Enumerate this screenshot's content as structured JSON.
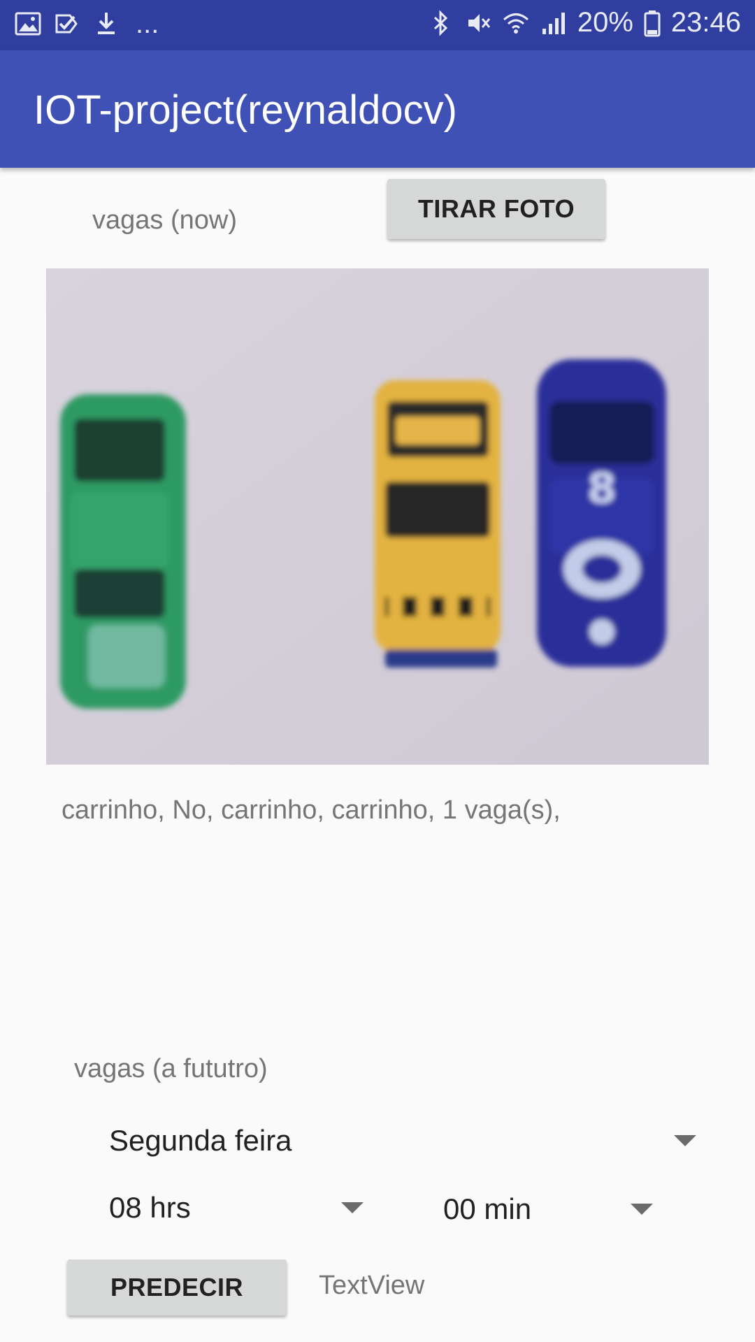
{
  "status_bar": {
    "left_icons": [
      "image-icon",
      "check-notification-icon",
      "download-icon"
    ],
    "more": "...",
    "right_icons": [
      "bluetooth-icon",
      "mute-icon",
      "wifi-icon",
      "signal-icon"
    ],
    "battery": "20%",
    "time": "23:46",
    "color": "#303f9f"
  },
  "app_bar": {
    "title": "IOT-project(reynaldocv)",
    "color": "#3f51b5"
  },
  "now_section": {
    "label": "vagas (now)",
    "photo_button": "TIRAR FOTO",
    "result": "carrinho, No, carrinho, carrinho, 1 vaga(s),"
  },
  "future_section": {
    "label": "vagas (a fututro)",
    "day_selected": "Segunda feira",
    "hour_selected": "08 hrs",
    "minute_selected": "00 min",
    "predict_button": "PREDECIR",
    "output": "TextView"
  }
}
